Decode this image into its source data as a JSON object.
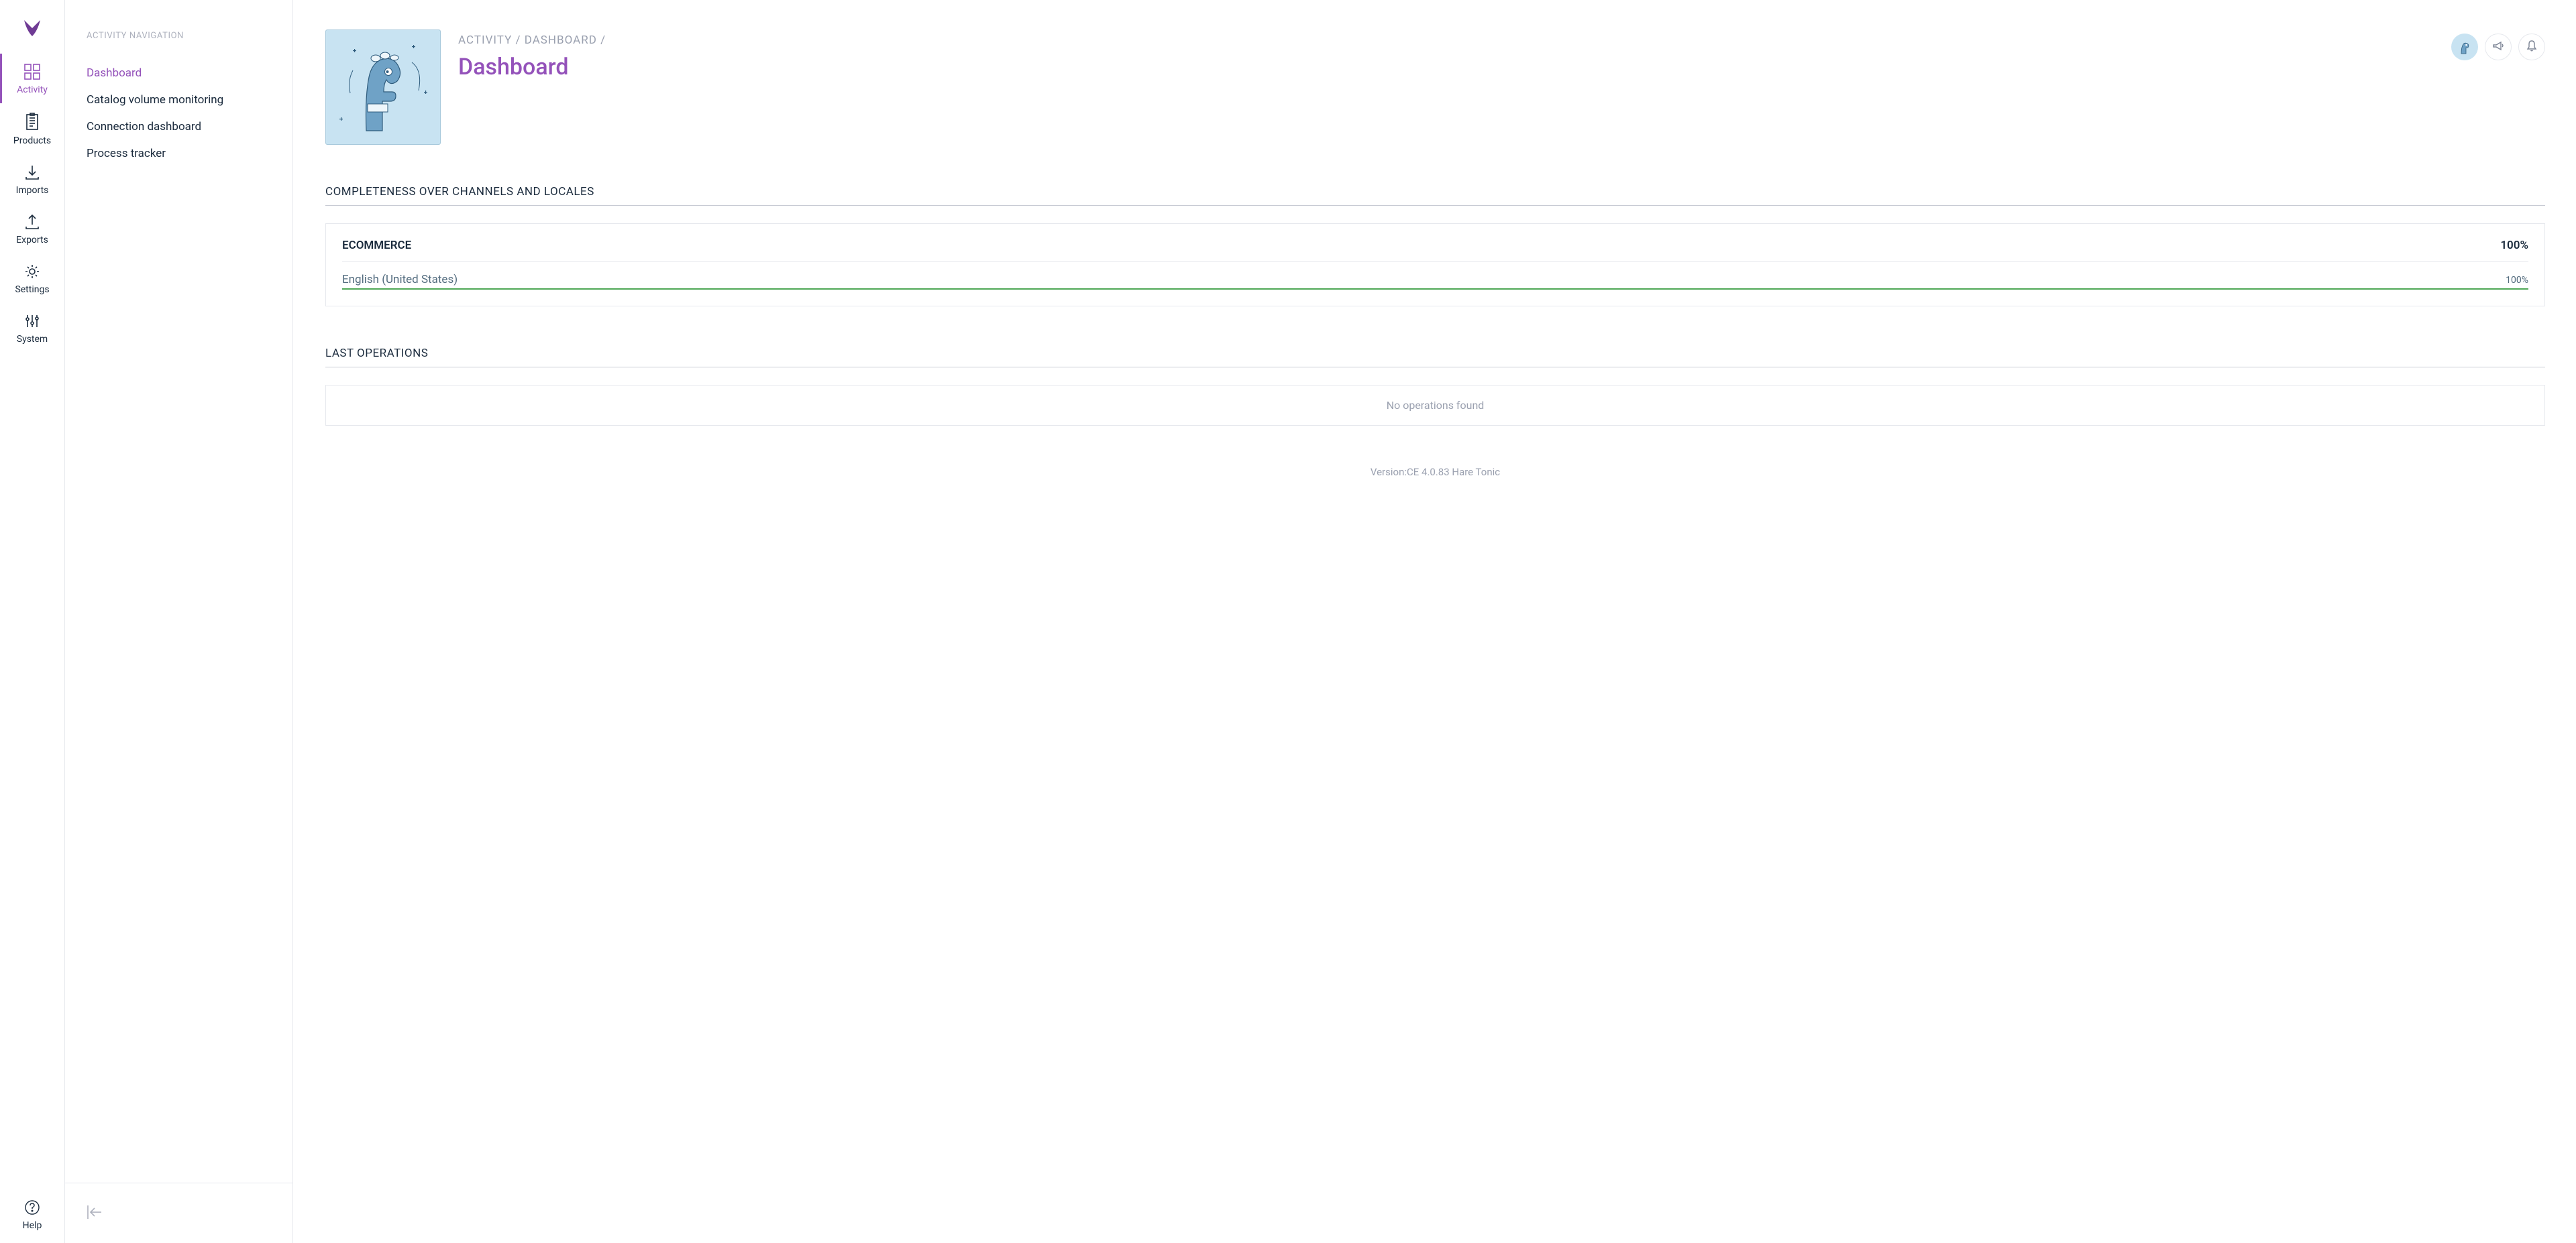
{
  "sidebar": {
    "items": [
      {
        "id": "activity",
        "label": "Activity",
        "active": true
      },
      {
        "id": "products",
        "label": "Products",
        "active": false
      },
      {
        "id": "imports",
        "label": "Imports",
        "active": false
      },
      {
        "id": "exports",
        "label": "Exports",
        "active": false
      },
      {
        "id": "settings",
        "label": "Settings",
        "active": false
      },
      {
        "id": "system",
        "label": "System",
        "active": false
      }
    ],
    "bottom": {
      "id": "help",
      "label": "Help"
    }
  },
  "subnav": {
    "title": "ACTIVITY NAVIGATION",
    "items": [
      {
        "id": "dashboard",
        "label": "Dashboard",
        "active": true
      },
      {
        "id": "catalog-vol",
        "label": "Catalog volume monitoring",
        "active": false
      },
      {
        "id": "conn-dash",
        "label": "Connection dashboard",
        "active": false
      },
      {
        "id": "proc-track",
        "label": "Process tracker",
        "active": false
      }
    ]
  },
  "header": {
    "breadcrumb": "ACTIVITY / DASHBOARD /",
    "title": "Dashboard"
  },
  "completeness": {
    "section_title": "COMPLETENESS OVER CHANNELS AND LOCALES",
    "channel_label": "ECOMMERCE",
    "channel_percent": "100%",
    "locale_label": "English (United States)",
    "locale_percent": "100%"
  },
  "last_ops": {
    "section_title": "LAST OPERATIONS",
    "empty_text": "No operations found"
  },
  "footer": {
    "version_text": "Version:CE 4.0.83 Hare Tonic"
  }
}
